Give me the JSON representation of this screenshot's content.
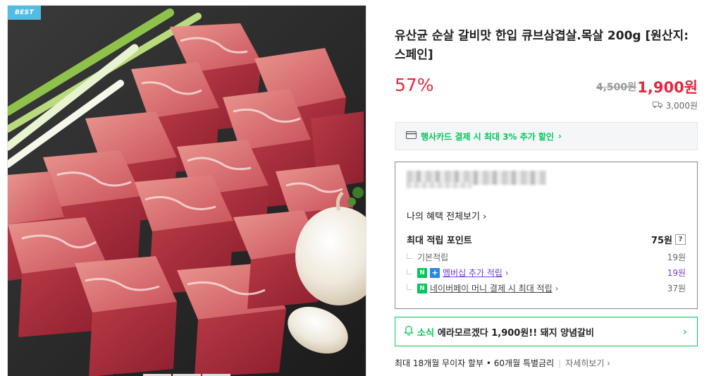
{
  "product": {
    "badge": "BEST",
    "title": "유산균 순살 갈비맛 한입 큐브삼겹살.목살 200g [원산지:스페인]",
    "discount_rate": "57%",
    "original_price": "4,500원",
    "sale_price": "1,900원",
    "delivery_fee": "3,000원",
    "image_slide_index": 1,
    "image_slide_count": 4
  },
  "card_banner": {
    "text": "행사카드 결제 시 최대 3% 추가 할인",
    "chevron": "›"
  },
  "benefits": {
    "link": "나의 혜택 전체보기",
    "points_label": "최대 적립 포인트",
    "points_value": "75원",
    "help": "?",
    "rows": [
      {
        "label": "기본적립",
        "value": "19원"
      },
      {
        "label": "멤버십 추가 적립",
        "value": "19원"
      },
      {
        "label": "네이버페이 머니 결제 시 최대 적립",
        "value": "37원"
      }
    ]
  },
  "news": {
    "tag": "소식",
    "message": "에라모르겠다 1,900원!! 돼지 양념갈비",
    "chevron": "›"
  },
  "installment": {
    "text": "최대 18개월 무이자 할부 • 60개월 특별금리",
    "more": "자세히보기"
  },
  "icons": {
    "delivery": "truck-icon",
    "card": "credit-card-icon",
    "news": "bell-icon",
    "membership": "naver-plus-icon",
    "npay": "naver-pay-icon"
  },
  "colors": {
    "accent_red": "#e4283e",
    "naver_green": "#03c75a",
    "membership_purple": "#6f3dd6",
    "badge_blue": "#53bce5"
  }
}
